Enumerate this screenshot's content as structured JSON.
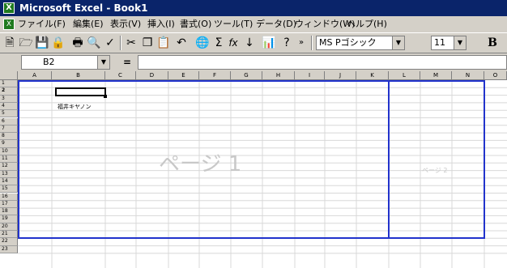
{
  "window": {
    "title": "Microsoft Excel - Book1"
  },
  "menu": {
    "items": [
      "ファイル(F)",
      "編集(E)",
      "表示(V)",
      "挿入(I)",
      "書式(O)",
      "ツール(T)",
      "データ(D)",
      "ウィンドウ(W)",
      "ヘルプ(H)"
    ]
  },
  "toolbar": {
    "icons": [
      "new-icon",
      "open-icon",
      "save-icon",
      "permission-icon",
      "print-icon",
      "print-preview-icon",
      "spelling-icon",
      "cut-icon",
      "copy-icon",
      "paste-icon",
      "undo-icon",
      "hyperlink-icon",
      "autosum-icon",
      "function-icon",
      "sort-ascending-icon",
      "chart-wizard-icon",
      "help-icon",
      "toolbar-options-icon",
      "bold-icon"
    ],
    "font_name": "MS Pゴシック",
    "font_size": "11",
    "bold_label": "B"
  },
  "formula_bar": {
    "name_box": "B2",
    "equals": "=",
    "content": ""
  },
  "sheet": {
    "columns": [
      "A",
      "B",
      "C",
      "D",
      "E",
      "F",
      "G",
      "H",
      "I",
      "J",
      "K",
      "L",
      "M",
      "N",
      "O"
    ],
    "rows": [
      "1",
      "2",
      "3",
      "4",
      "5",
      "6",
      "7",
      "8",
      "9",
      "10",
      "11",
      "12",
      "13",
      "14",
      "15",
      "16",
      "17",
      "18",
      "19",
      "20",
      "21",
      "22",
      "23"
    ],
    "selected_cell": "B2",
    "cells": [
      {
        "ref": "B4",
        "value": "福井キヤノン"
      }
    ],
    "page_labels": [
      "ページ 1",
      "ページ 2"
    ]
  }
}
